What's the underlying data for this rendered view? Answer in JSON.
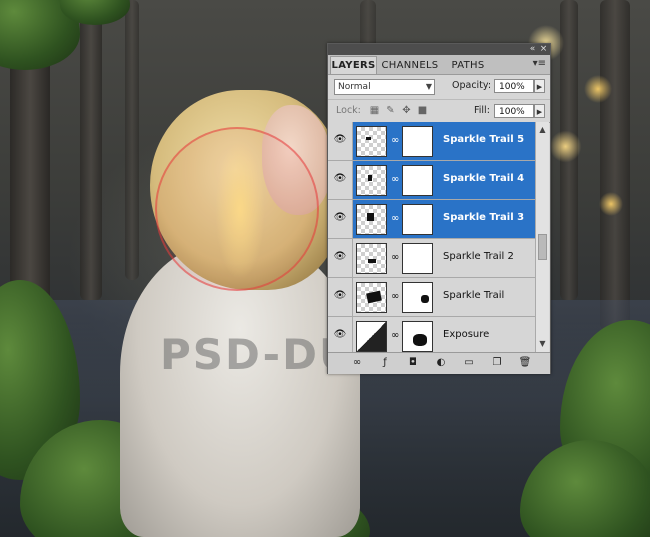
{
  "panel": {
    "tabs": [
      {
        "label": "LAYERS",
        "active": true
      },
      {
        "label": "CHANNELS",
        "active": false
      },
      {
        "label": "PATHS",
        "active": false
      }
    ],
    "blend_mode": "Normal",
    "opacity_label": "Opacity:",
    "opacity_value": "100%",
    "lock_label": "Lock:",
    "fill_label": "Fill:",
    "fill_value": "100%",
    "layers": [
      {
        "name": "Sparkle Trail 5",
        "selected": true,
        "visible": true
      },
      {
        "name": "Sparkle Trail 4",
        "selected": true,
        "visible": true
      },
      {
        "name": "Sparkle Trail 3",
        "selected": true,
        "visible": true
      },
      {
        "name": "Sparkle Trail 2",
        "selected": false,
        "visible": true
      },
      {
        "name": "Sparkle Trail",
        "selected": false,
        "visible": true
      },
      {
        "name": "Exposure",
        "selected": false,
        "visible": true
      }
    ],
    "icons": {
      "eye": "eye-icon",
      "chain": "chain-link-icon",
      "menu": "panel-menu-icon",
      "lock": [
        "lock-transparent-icon",
        "lock-brush-icon",
        "lock-move-icon",
        "lock-all-icon"
      ],
      "bottom": [
        "link-layers-icon",
        "fx-icon",
        "add-mask-icon",
        "adjustment-layer-icon",
        "new-group-icon",
        "new-layer-icon",
        "trash-icon"
      ]
    },
    "selection_color": "#2a73c7"
  },
  "watermark": "PSD-DUDE.COM"
}
